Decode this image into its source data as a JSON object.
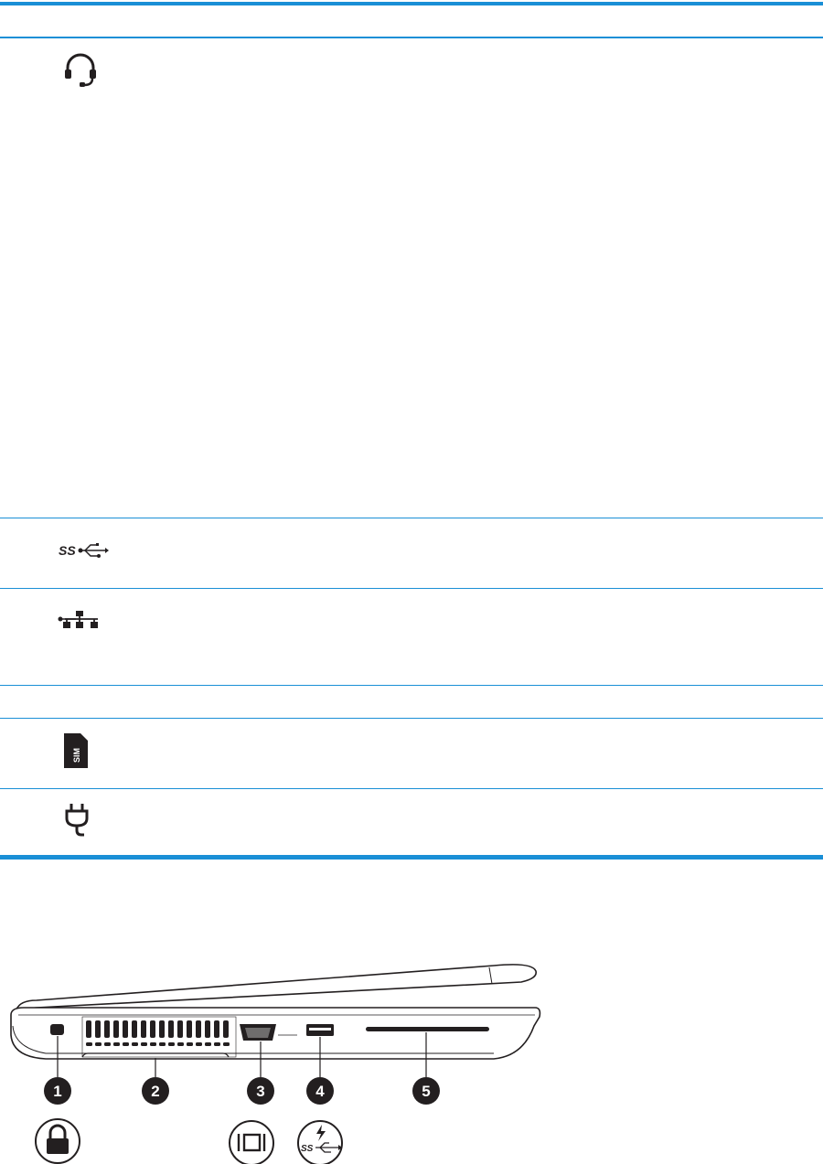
{
  "table": {
    "rows": [
      {
        "icon": "headset-icon",
        "height": "tall"
      },
      {
        "icon": "usb-superspeed-icon"
      },
      {
        "icon": "network-rj45-icon"
      },
      {
        "icon": "none"
      },
      {
        "icon": "sim-card-icon",
        "icon_text": "SIM"
      },
      {
        "icon": "power-plug-icon"
      }
    ]
  },
  "figure": {
    "callouts": [
      "1",
      "2",
      "3",
      "4",
      "5"
    ],
    "port_icons": [
      "lock-icon",
      "display-vga-icon",
      "usb-superspeed-charging-icon"
    ],
    "accent_color": "#1a8fd6"
  }
}
